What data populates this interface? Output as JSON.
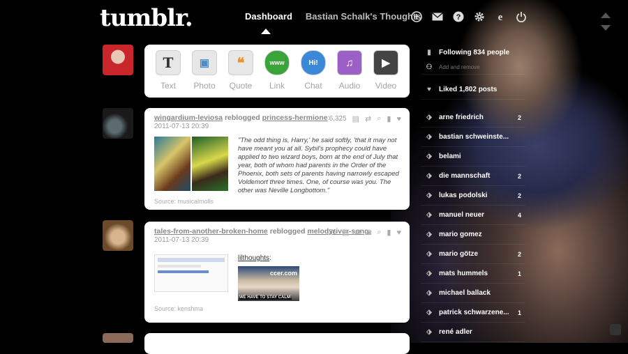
{
  "brand": {
    "logo": "tumblr."
  },
  "nav": {
    "dashboard": "Dashboard",
    "blog": "Bastian Schalk's Thoughts",
    "icons": [
      "plus-icon",
      "mail-icon",
      "help-icon",
      "gear-icon",
      "user-icon",
      "power-icon"
    ]
  },
  "composer": [
    {
      "label": "Text",
      "glyph": "T"
    },
    {
      "label": "Photo",
      "glyph": "▣"
    },
    {
      "label": "Quote",
      "glyph": "❝"
    },
    {
      "label": "Link",
      "glyph": "www"
    },
    {
      "label": "Chat",
      "glyph": "Hi!"
    },
    {
      "label": "Audio",
      "glyph": "♫"
    },
    {
      "label": "Video",
      "glyph": "▶"
    }
  ],
  "posts": [
    {
      "author": "wingardium-leviosa",
      "verb": "reblogged",
      "source_user": "princess-hermione",
      "date": "2011-07-13 20:39",
      "notes": "6,325",
      "quote": "\"The odd thing is, Harry,' he said softly, 'that it may not have meant you at all. Sybil's prophecy could have applied to two wizard boys, born at the end of July that year, both of whom had parents in the Order of the Phoenix, both sets of parents having narrowly escaped Voldemort three times. One, of course was you. The other was Neville Longbottom.\"",
      "source": "Source: musicalmolls"
    },
    {
      "author": "tales-from-another-broken-home",
      "verb": "reblogged",
      "source_user": "melodyriver-song",
      "date": "2011-07-13 20:39",
      "notes": "36",
      "caption_user": "lilthoughts",
      "caption_tail": ":",
      "image_text": "WE HAVE TO STAY CALM!",
      "image_site": "ccer.com",
      "source": "Source: kenshma"
    }
  ],
  "sidebar": {
    "following": "Following 834 people",
    "add": "Add and remove",
    "liked": "Liked 1,802 posts",
    "tags": [
      {
        "name": "arne friedrich",
        "count": "2"
      },
      {
        "name": "bastian schweinste...",
        "count": ""
      },
      {
        "name": "belami",
        "count": ""
      },
      {
        "name": "die mannschaft",
        "count": "2"
      },
      {
        "name": "lukas podolski",
        "count": "2"
      },
      {
        "name": "manuel neuer",
        "count": "4"
      },
      {
        "name": "mario gomez",
        "count": ""
      },
      {
        "name": "mario götze",
        "count": "2"
      },
      {
        "name": "mats hummels",
        "count": "1"
      },
      {
        "name": "michael ballack",
        "count": ""
      },
      {
        "name": "patrick schwarzene...",
        "count": "1"
      },
      {
        "name": "rené adler",
        "count": ""
      }
    ]
  }
}
